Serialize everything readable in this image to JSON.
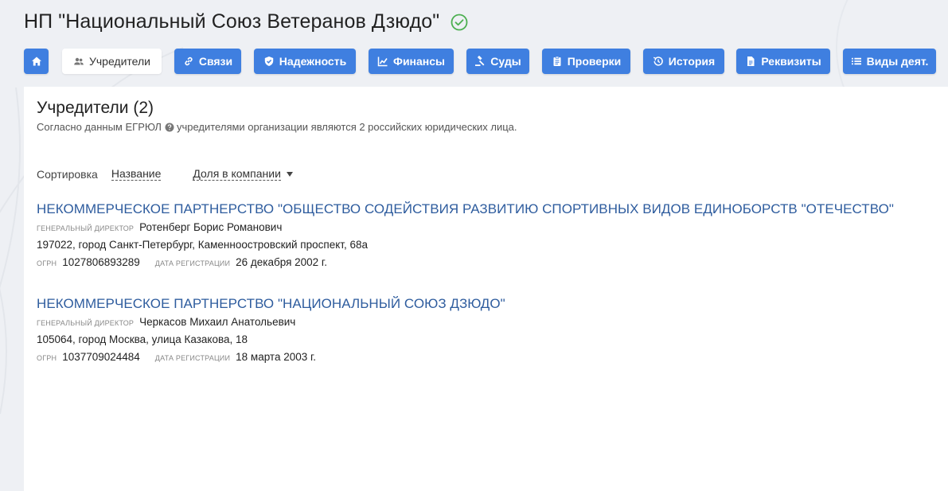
{
  "header": {
    "org_title": "НП \"Национальный Союз Ветеранов Дзюдо\"",
    "verified_icon": "check-circle-icon",
    "colors": {
      "accent": "#3f7fe0",
      "verified": "#4caf50"
    }
  },
  "nav": {
    "home_icon": "home-icon",
    "items": [
      {
        "label": "Учредители",
        "icon": "people-icon",
        "active": true
      },
      {
        "label": "Связи",
        "icon": "link-icon"
      },
      {
        "label": "Надежность",
        "icon": "shield-icon"
      },
      {
        "label": "Финансы",
        "icon": "chart-icon"
      },
      {
        "label": "Суды",
        "icon": "gavel-icon"
      },
      {
        "label": "Проверки",
        "icon": "clipboard-icon"
      },
      {
        "label": "История",
        "icon": "history-icon"
      },
      {
        "label": "Реквизиты",
        "icon": "document-icon"
      },
      {
        "label": "Виды деят.",
        "icon": "list-icon"
      }
    ]
  },
  "section": {
    "title": "Учредители (2)",
    "subtitle_before": "Согласно данным ЕГРЮЛ",
    "subtitle_after": "учредителями организации являются 2 российских юридических лица."
  },
  "sort": {
    "label": "Сортировка",
    "by_name": "Название",
    "by_share": "Доля в компании"
  },
  "companies": [
    {
      "name": "НЕКОММЕРЧЕСКОЕ ПАРТНЕРСТВО \"ОБЩЕСТВО СОДЕЙСТВИЯ РАЗВИТИЮ СПОРТИВНЫХ ВИДОВ ЕДИНОБОРСТВ \"ОТЕЧЕСТВО\"",
      "director_label": "Генеральный директор",
      "director": "Ротенберг Борис Романович",
      "address": "197022, город Санкт-Петербург, Каменноостровский проспект, 68а",
      "ogrn_label": "ОГРН",
      "ogrn": "1027806893289",
      "reg_label": "Дата регистрации",
      "reg_date": "26 декабря 2002 г."
    },
    {
      "name": "НЕКОММЕРЧЕСКОЕ ПАРТНЕРСТВО \"НАЦИОНАЛЬНЫЙ СОЮЗ ДЗЮДО\"",
      "director_label": "Генеральный директор",
      "director": "Черкасов Михаил Анатольевич",
      "address": "105064, город Москва, улица Казакова, 18",
      "ogrn_label": "ОГРН",
      "ogrn": "1037709024484",
      "reg_label": "Дата регистрации",
      "reg_date": "18 марта 2003 г."
    }
  ]
}
